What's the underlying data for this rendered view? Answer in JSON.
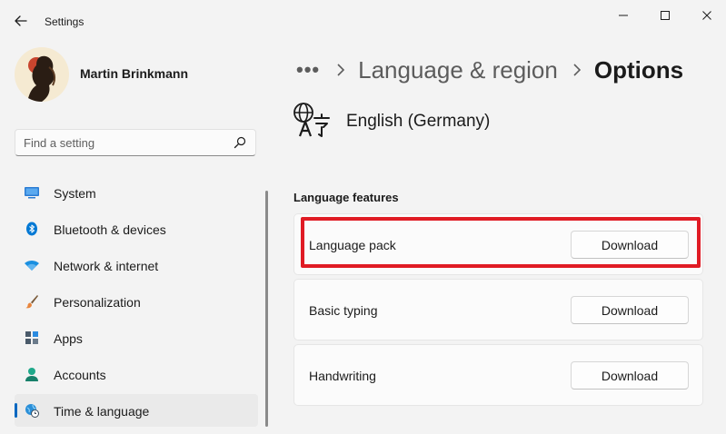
{
  "window": {
    "title": "Settings",
    "controls": {
      "minimize_icon": "minimize-icon",
      "maximize_icon": "maximize-icon",
      "close_icon": "close-icon"
    }
  },
  "profile": {
    "name": "Martin Brinkmann"
  },
  "search": {
    "placeholder": "Find a setting",
    "value": ""
  },
  "sidebar": {
    "items": [
      {
        "label": "System",
        "icon": "monitor-icon",
        "color": "#2b7cd3"
      },
      {
        "label": "Bluetooth & devices",
        "icon": "bluetooth-icon",
        "color": "#0078d4"
      },
      {
        "label": "Network & internet",
        "icon": "wifi-icon",
        "color": "#1a8fe0"
      },
      {
        "label": "Personalization",
        "icon": "paint-brush-icon",
        "color": "#e8853c"
      },
      {
        "label": "Apps",
        "icon": "apps-icon",
        "color": "#4a5a6a"
      },
      {
        "label": "Accounts",
        "icon": "person-icon",
        "color": "#1fa88a"
      },
      {
        "label": "Time & language",
        "icon": "globe-clock-icon",
        "color": "#2a8fd8",
        "active": true
      }
    ]
  },
  "breadcrumb": {
    "more": "•••",
    "parent": "Language & region",
    "current": "Options"
  },
  "language": {
    "name": "English (Germany)",
    "icon": "language-icon"
  },
  "features": {
    "title": "Language features",
    "items": [
      {
        "label": "Language pack",
        "button": "Download",
        "highlighted": true
      },
      {
        "label": "Basic typing",
        "button": "Download"
      },
      {
        "label": "Handwriting",
        "button": "Download"
      }
    ]
  },
  "colors": {
    "accent": "#0067c0",
    "highlight": "#e01b24"
  }
}
